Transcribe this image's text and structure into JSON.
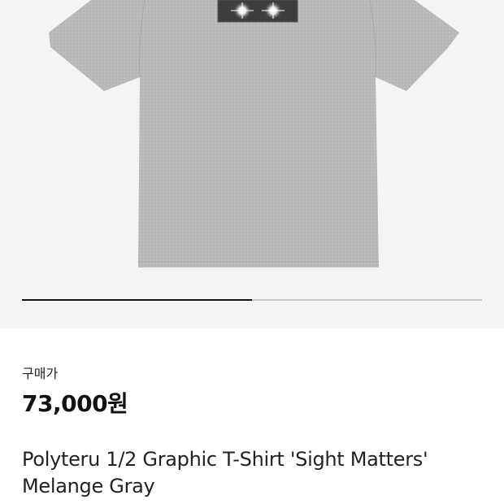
{
  "gallery": {
    "image_name": "gray t-shirt product photo",
    "slide_progress": 0.5
  },
  "colors": {
    "shirt": "#b8b8b8",
    "gallery_bg": "#f4f4f4",
    "indicator_active": "#111111",
    "indicator_track": "#c8c8c8"
  },
  "price": {
    "label": "구매가",
    "value": "73,000원"
  },
  "product": {
    "title": "Polyteru 1/2 Graphic T-Shirt 'Sight Matters' Melange Gray"
  }
}
